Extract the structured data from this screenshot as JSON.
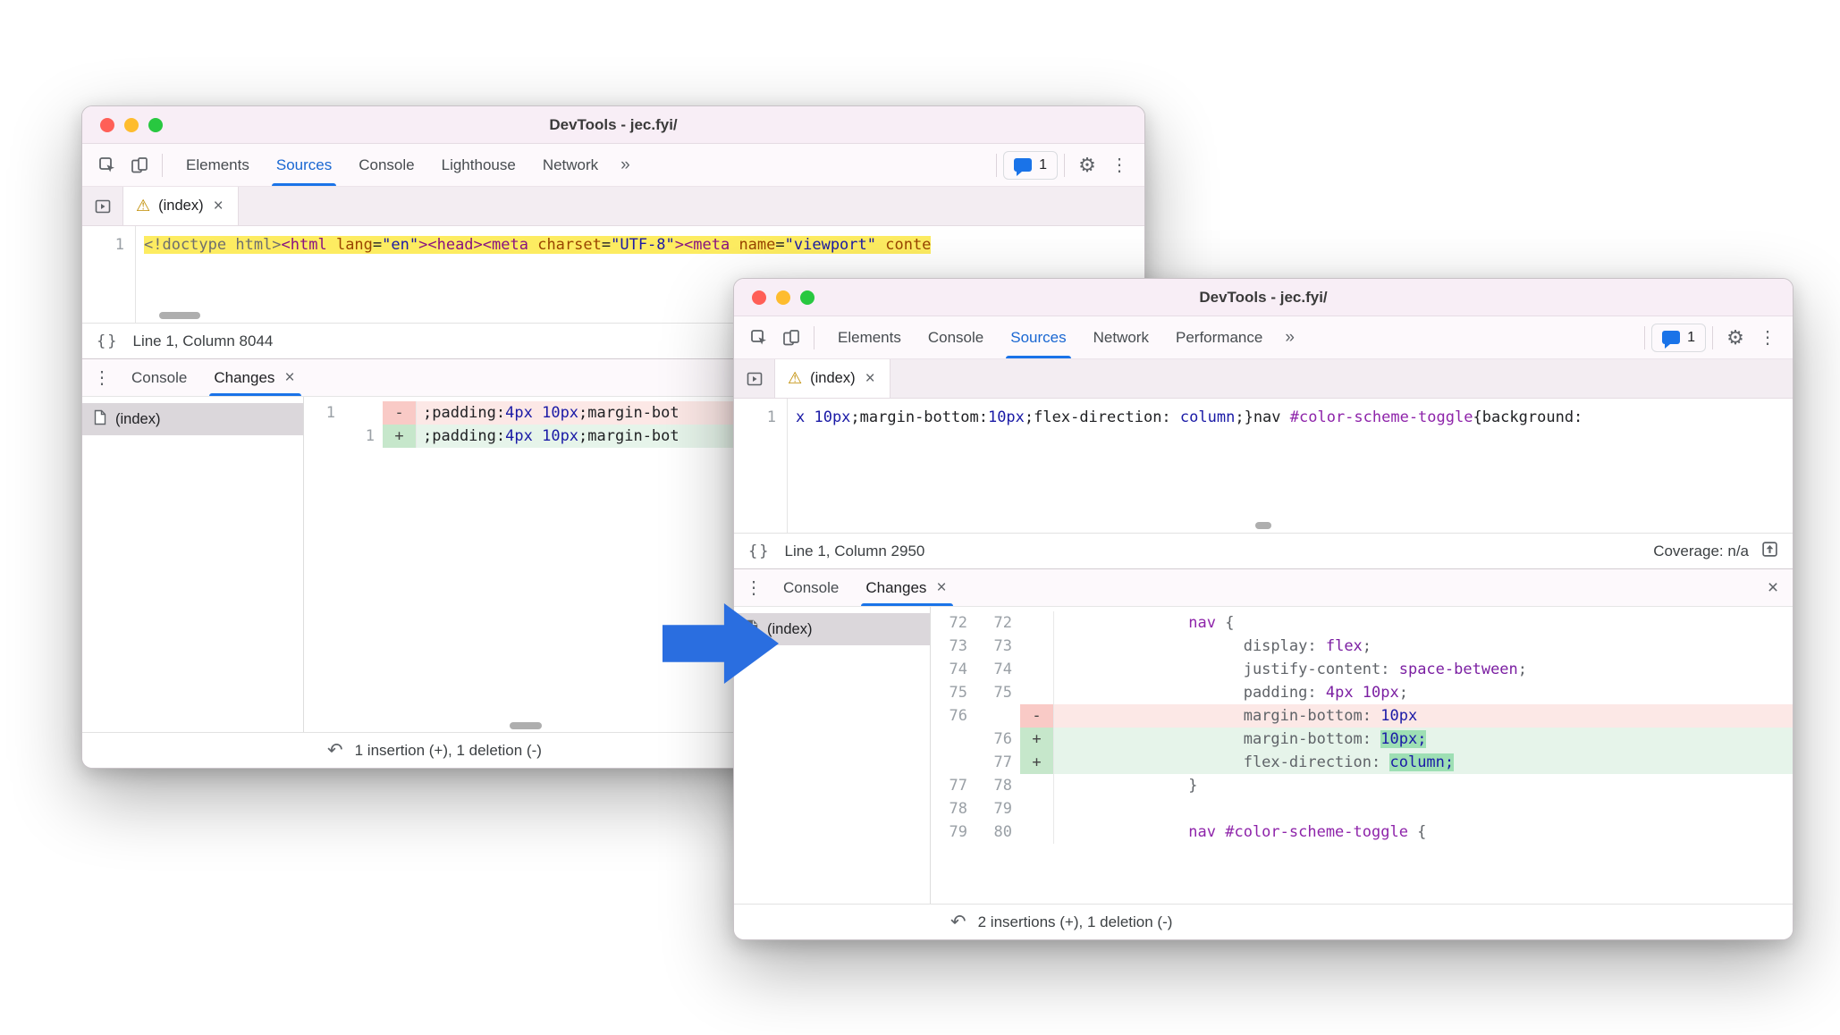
{
  "icons": {
    "gear": "⚙",
    "overflow": "⋮",
    "undo": "↶",
    "braces": "{}",
    "warning": "⚠",
    "close": "×",
    "more_tabs": "»"
  },
  "colors": {
    "accent": "#1a73e8",
    "arrow": "#2a6ee0",
    "traffic_close": "#ff5f57",
    "traffic_min": "#febc2e",
    "traffic_zoom": "#28c840",
    "diff_del_bg": "#fce8e6",
    "diff_add_bg": "#e6f4ea",
    "highlight_yellow": "#fdec61"
  },
  "back": {
    "title": "DevTools - jec.fyi/",
    "toolbar": {
      "tabs": {
        "elements": "Elements",
        "sources": "Sources",
        "console": "Console",
        "lighthouse": "Lighthouse",
        "network": "Network"
      },
      "issues_count": "1"
    },
    "filebar": {
      "file_tab": "(index)"
    },
    "source": {
      "line_no": "1",
      "code": [
        {
          "t": "<!doctype html>",
          "c": "doctype"
        },
        {
          "t": "<html",
          "c": "tag"
        },
        {
          "t": " lang",
          "c": "attr"
        },
        {
          "t": "=",
          "c": "plain"
        },
        {
          "t": "\"en\"",
          "c": "str"
        },
        {
          "t": ">",
          "c": "tag"
        },
        {
          "t": "<head>",
          "c": "tag"
        },
        {
          "t": "<meta",
          "c": "tag"
        },
        {
          "t": " charset",
          "c": "attr"
        },
        {
          "t": "=",
          "c": "plain"
        },
        {
          "t": "\"UTF-8\"",
          "c": "str"
        },
        {
          "t": ">",
          "c": "tag"
        },
        {
          "t": "<meta",
          "c": "tag"
        },
        {
          "t": " name",
          "c": "attr"
        },
        {
          "t": "=",
          "c": "plain"
        },
        {
          "t": "\"viewport\"",
          "c": "str"
        },
        {
          "t": " conte",
          "c": "attr"
        }
      ]
    },
    "statusbar": {
      "line_col": "Line 1, Column 8044"
    },
    "drawer": {
      "tabs": {
        "console": "Console",
        "changes": "Changes"
      },
      "file_item": "(index)",
      "diff_rows": [
        {
          "old": "1",
          "new": "",
          "marker": "-",
          "code": [
            {
              "t": ";padding:",
              "c": "plain"
            },
            {
              "t": "4px",
              "c": "num"
            },
            {
              "t": " ",
              "c": "plain"
            },
            {
              "t": "10px",
              "c": "num"
            },
            {
              "t": ";margin-bot",
              "c": "plain"
            }
          ]
        },
        {
          "old": "",
          "new": "1",
          "marker": "+",
          "code": [
            {
              "t": ";padding:",
              "c": "plain"
            },
            {
              "t": "4px",
              "c": "num"
            },
            {
              "t": " ",
              "c": "plain"
            },
            {
              "t": "10px",
              "c": "num"
            },
            {
              "t": ";margin-bot",
              "c": "plain"
            }
          ]
        }
      ],
      "summary": "1 insertion (+), 1 deletion (-)"
    }
  },
  "front": {
    "title": "DevTools - jec.fyi/",
    "toolbar": {
      "tabs": {
        "elements": "Elements",
        "console": "Console",
        "sources": "Sources",
        "network": "Network",
        "performance": "Performance"
      },
      "issues_count": "1"
    },
    "filebar": {
      "file_tab": "(index)"
    },
    "source": {
      "line_no": "1",
      "code": [
        {
          "t": "x 10px",
          "c": "num"
        },
        {
          "t": ";margin-bottom:",
          "c": "plain"
        },
        {
          "t": "10px",
          "c": "num"
        },
        {
          "t": ";flex-direction: ",
          "c": "plain"
        },
        {
          "t": "column",
          "c": "num"
        },
        {
          "t": ";}",
          "c": "plain"
        },
        {
          "t": "nav ",
          "c": "plain"
        },
        {
          "t": "#color-scheme-toggle",
          "c": "sel"
        },
        {
          "t": "{background:",
          "c": "plain"
        }
      ]
    },
    "statusbar": {
      "line_col": "Line 1, Column 2950",
      "coverage": "Coverage: n/a"
    },
    "drawer": {
      "tabs": {
        "console": "Console",
        "changes": "Changes"
      },
      "file_item": "(index)",
      "diff_rows": [
        {
          "old": "72",
          "new": "72",
          "marker": "",
          "code": [
            {
              "t": "              ",
              "c": "plain"
            },
            {
              "t": "nav",
              "c": "sel"
            },
            {
              "t": " {",
              "c": "brace"
            }
          ]
        },
        {
          "old": "73",
          "new": "73",
          "marker": "",
          "code": [
            {
              "t": "                    ",
              "c": "plain"
            },
            {
              "t": "display",
              "c": "prop"
            },
            {
              "t": ": ",
              "c": "brace"
            },
            {
              "t": "flex",
              "c": "val"
            },
            {
              "t": ";",
              "c": "brace"
            }
          ]
        },
        {
          "old": "74",
          "new": "74",
          "marker": "",
          "code": [
            {
              "t": "                    ",
              "c": "plain"
            },
            {
              "t": "justify-content",
              "c": "prop"
            },
            {
              "t": ": ",
              "c": "brace"
            },
            {
              "t": "space-between",
              "c": "val"
            },
            {
              "t": ";",
              "c": "brace"
            }
          ]
        },
        {
          "old": "75",
          "new": "75",
          "marker": "",
          "code": [
            {
              "t": "                    ",
              "c": "plain"
            },
            {
              "t": "padding",
              "c": "prop"
            },
            {
              "t": ": ",
              "c": "brace"
            },
            {
              "t": "4px 10px",
              "c": "val"
            },
            {
              "t": ";",
              "c": "brace"
            }
          ]
        },
        {
          "old": "76",
          "new": "",
          "marker": "-",
          "code": [
            {
              "t": "                    ",
              "c": "plain"
            },
            {
              "t": "margin-bottom",
              "c": "prop"
            },
            {
              "t": ": ",
              "c": "brace"
            },
            {
              "t": "10px",
              "c": "num"
            }
          ]
        },
        {
          "old": "",
          "new": "76",
          "marker": "+",
          "code": [
            {
              "t": "                    ",
              "c": "plain"
            },
            {
              "t": "margin-bottom",
              "c": "prop"
            },
            {
              "t": ": ",
              "c": "brace"
            },
            {
              "t": "10px;",
              "c": "num em-add"
            }
          ]
        },
        {
          "old": "",
          "new": "77",
          "marker": "+",
          "code": [
            {
              "t": "                    ",
              "c": "plain"
            },
            {
              "t": "flex-direction",
              "c": "prop"
            },
            {
              "t": ": ",
              "c": "brace"
            },
            {
              "t": "column;",
              "c": "num em-add"
            }
          ]
        },
        {
          "old": "77",
          "new": "78",
          "marker": "",
          "code": [
            {
              "t": "              }",
              "c": "brace"
            }
          ]
        },
        {
          "old": "78",
          "new": "79",
          "marker": "",
          "code": []
        },
        {
          "old": "79",
          "new": "80",
          "marker": "",
          "code": [
            {
              "t": "              ",
              "c": "plain"
            },
            {
              "t": "nav #color-scheme-toggle",
              "c": "sel"
            },
            {
              "t": " {",
              "c": "brace"
            }
          ]
        }
      ],
      "summary": "2 insertions (+), 1 deletion (-)"
    }
  }
}
